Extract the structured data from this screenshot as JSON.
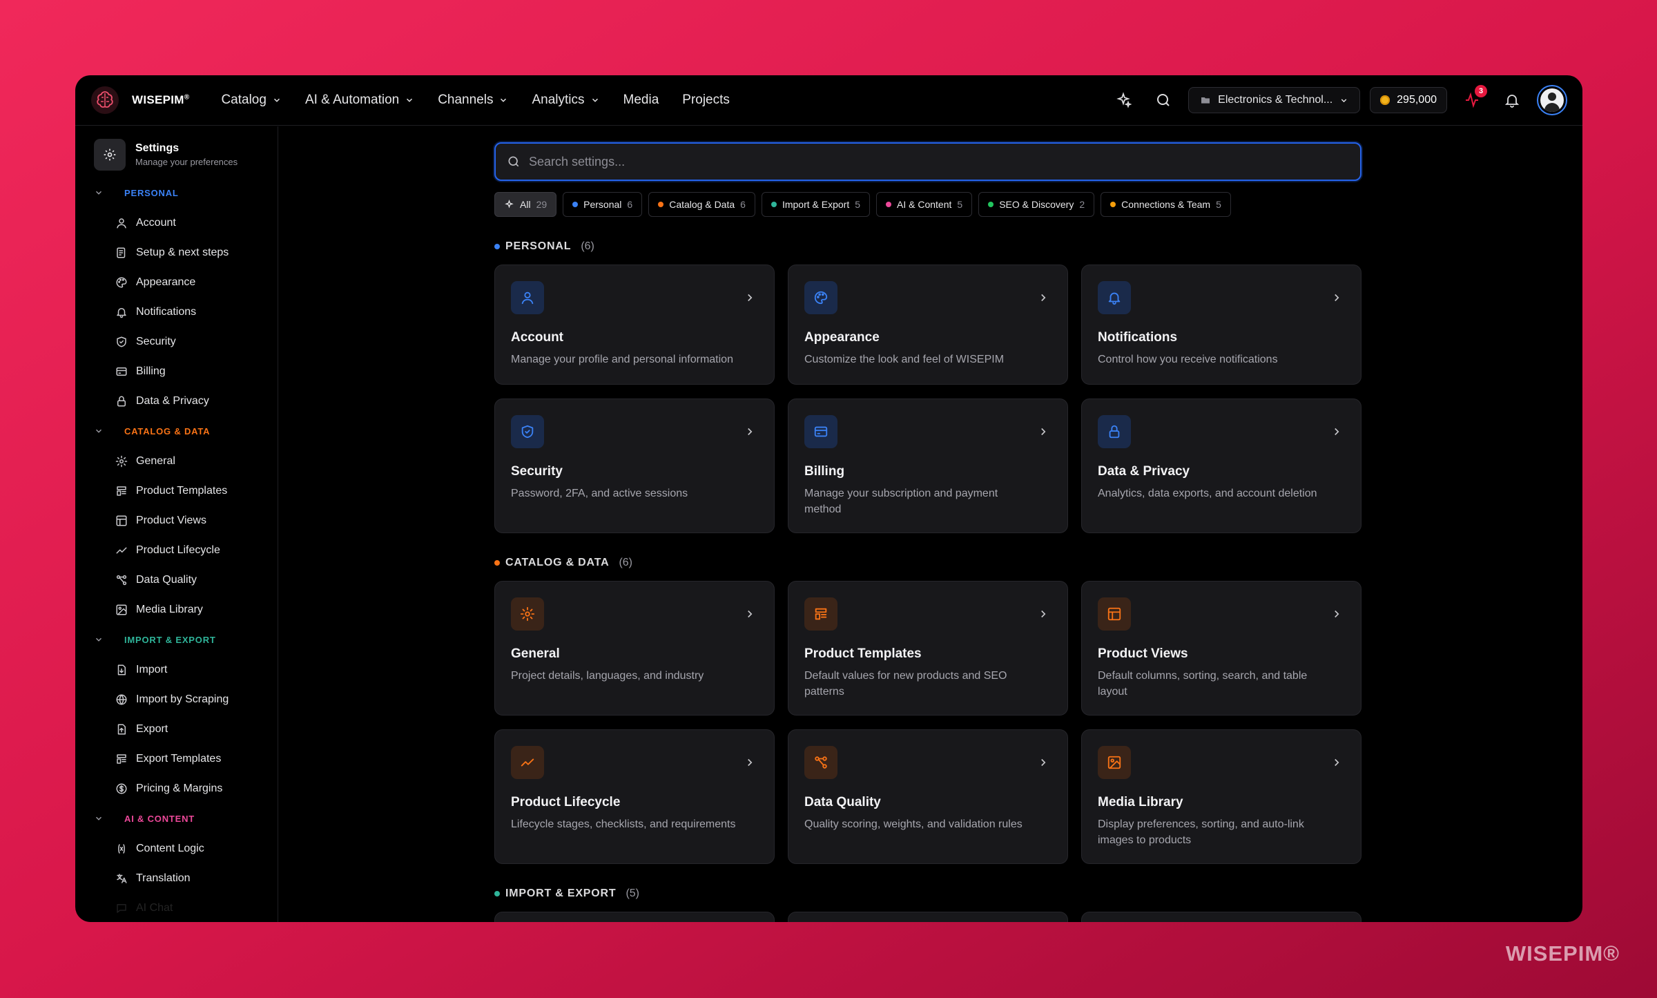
{
  "app": {
    "logo_text": "WISEPIM",
    "logo_mark": "®"
  },
  "nav": [
    {
      "label": "Catalog",
      "dropdown": true
    },
    {
      "label": "AI & Automation",
      "dropdown": true
    },
    {
      "label": "Channels",
      "dropdown": true
    },
    {
      "label": "Analytics",
      "dropdown": true
    },
    {
      "label": "Media",
      "dropdown": false
    },
    {
      "label": "Projects",
      "dropdown": false
    }
  ],
  "topright": {
    "project": "Electronics & Technol...",
    "credits": "295,000",
    "activity_badge": "3"
  },
  "sidebar": {
    "title": "Settings",
    "subtitle": "Manage your preferences",
    "groups": [
      {
        "label": "PERSONAL",
        "color": "#3b82f6",
        "items": [
          "Account",
          "Setup & next steps",
          "Appearance",
          "Notifications",
          "Security",
          "Billing",
          "Data & Privacy"
        ]
      },
      {
        "label": "CATALOG & DATA",
        "color": "#f97316",
        "items": [
          "General",
          "Product Templates",
          "Product Views",
          "Product Lifecycle",
          "Data Quality",
          "Media Library"
        ]
      },
      {
        "label": "IMPORT & EXPORT",
        "color": "#2fb59a",
        "items": [
          "Import",
          "Import by Scraping",
          "Export",
          "Export Templates",
          "Pricing & Margins"
        ]
      },
      {
        "label": "AI & CONTENT",
        "color": "#ec4899",
        "items": [
          "Content Logic",
          "Translation",
          "AI Chat"
        ]
      }
    ]
  },
  "search": {
    "placeholder": "Search settings..."
  },
  "chips": [
    {
      "label": "All",
      "count": "29",
      "color": ""
    },
    {
      "label": "Personal",
      "count": "6",
      "color": "#3b82f6"
    },
    {
      "label": "Catalog & Data",
      "count": "6",
      "color": "#f97316"
    },
    {
      "label": "Import & Export",
      "count": "5",
      "color": "#2fb59a"
    },
    {
      "label": "AI & Content",
      "count": "5",
      "color": "#ec4899"
    },
    {
      "label": "SEO & Discovery",
      "count": "2",
      "color": "#22c55e"
    },
    {
      "label": "Connections & Team",
      "count": "5",
      "color": "#f59e0b"
    }
  ],
  "sections": {
    "personal": {
      "label": "PERSONAL",
      "count": "(6)",
      "color": "#3b82f6",
      "cards": [
        {
          "title": "Account",
          "desc": "Manage your profile and personal information",
          "icon": "user-icon"
        },
        {
          "title": "Appearance",
          "desc": "Customize the look and feel of WISEPIM",
          "icon": "palette-icon"
        },
        {
          "title": "Notifications",
          "desc": "Control how you receive notifications",
          "icon": "bell-icon"
        },
        {
          "title": "Security",
          "desc": "Password, 2FA, and active sessions",
          "icon": "shield-icon"
        },
        {
          "title": "Billing",
          "desc": "Manage your subscription and payment method",
          "icon": "credit-card-icon"
        },
        {
          "title": "Data & Privacy",
          "desc": "Analytics, data exports, and account deletion",
          "icon": "lock-icon"
        }
      ]
    },
    "catalog": {
      "label": "CATALOG & DATA",
      "count": "(6)",
      "color": "#f97316",
      "cards": [
        {
          "title": "General",
          "desc": "Project details, languages, and industry",
          "icon": "gear-icon"
        },
        {
          "title": "Product Templates",
          "desc": "Default values for new products and SEO patterns",
          "icon": "template-icon"
        },
        {
          "title": "Product Views",
          "desc": "Default columns, sorting, search, and table layout",
          "icon": "table-icon"
        },
        {
          "title": "Product Lifecycle",
          "desc": "Lifecycle stages, checklists, and requirements",
          "icon": "trend-icon"
        },
        {
          "title": "Data Quality",
          "desc": "Quality scoring, weights, and validation rules",
          "icon": "workflow-icon"
        },
        {
          "title": "Media Library",
          "desc": "Display preferences, sorting, and auto-link images to products",
          "icon": "image-icon"
        }
      ]
    },
    "import": {
      "label": "IMPORT & EXPORT",
      "count": "(5)",
      "color": "#2fb59a"
    }
  },
  "watermark": "WISEPIM®"
}
